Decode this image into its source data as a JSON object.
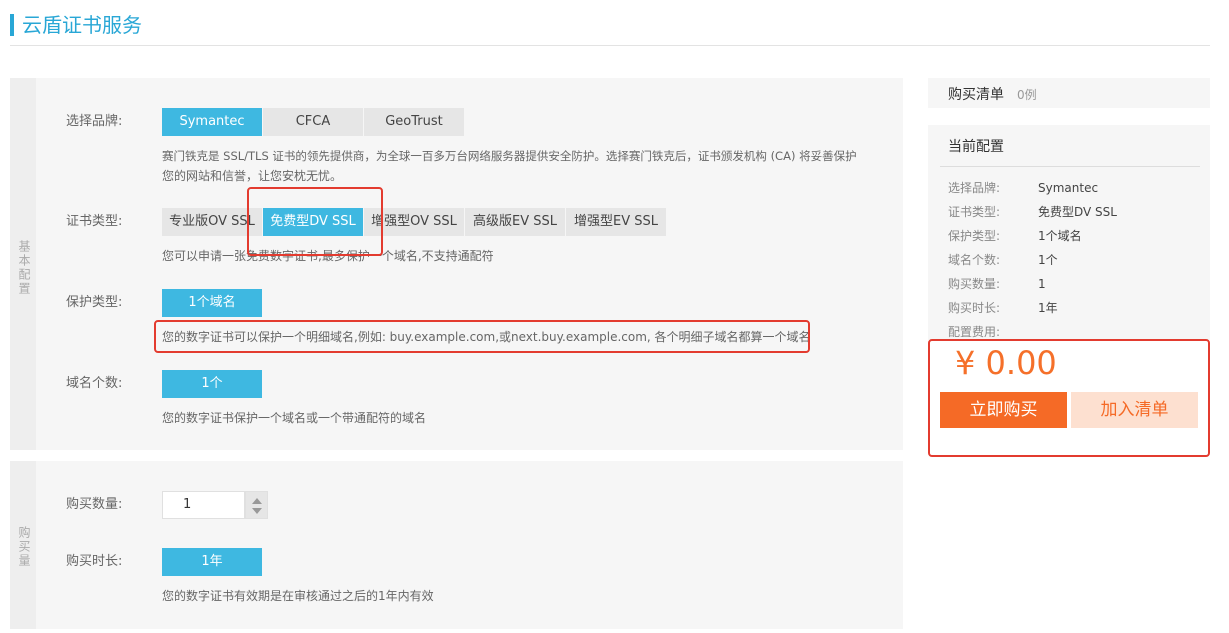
{
  "page": {
    "title": "云盾证书服务"
  },
  "sections": {
    "basic_label": "基本配置",
    "purchase_label": "购买量"
  },
  "brand": {
    "label": "选择品牌:",
    "options": [
      "Symantec",
      "CFCA",
      "GeoTrust"
    ],
    "selected": "Symantec",
    "description_line1": "赛门铁克是 SSL/TLS 证书的领先提供商，为全球一百多万台网络服务器提供安全防护。选择赛门铁克后，证书颁发机构 (CA) 将妥善保护",
    "description_line2": "您的网站和信誉，让您安枕无忧。"
  },
  "cert_type": {
    "label": "证书类型:",
    "options": [
      "专业版OV SSL",
      "免费型DV SSL",
      "增强型OV SSL",
      "高级版EV SSL",
      "增强型EV SSL"
    ],
    "selected": "免费型DV SSL",
    "description": "您可以申请一张免费数字证书,最多保护一个域名,不支持通配符"
  },
  "protect_type": {
    "label": "保护类型:",
    "options": [
      "1个域名"
    ],
    "selected": "1个域名",
    "description": "您的数字证书可以保护一个明细域名,例如: buy.example.com,或next.buy.example.com, 各个明细子域名都算一个域名"
  },
  "domain_count": {
    "label": "域名个数:",
    "options": [
      "1个"
    ],
    "selected": "1个",
    "description": "您的数字证书保护一个域名或一个带通配符的域名"
  },
  "quantity": {
    "label": "购买数量:",
    "value": "1"
  },
  "duration": {
    "label": "购买时长:",
    "options": [
      "1年"
    ],
    "selected": "1年",
    "description": "您的数字证书有效期是在审核通过之后的1年内有效"
  },
  "cart": {
    "title": "购买清单",
    "count": "0例"
  },
  "config": {
    "title": "当前配置",
    "rows": [
      {
        "label": "选择品牌:",
        "value": "Symantec"
      },
      {
        "label": "证书类型:",
        "value": "免费型DV SSL"
      },
      {
        "label": "保护类型:",
        "value": "1个域名"
      },
      {
        "label": "域名个数:",
        "value": "1个"
      },
      {
        "label": "购买数量:",
        "value": "1"
      },
      {
        "label": "购买时长:",
        "value": "1年"
      }
    ],
    "fee_label": "配置费用:",
    "price": "¥ 0.00",
    "buy_button": "立即购买",
    "add_button": "加入清单"
  },
  "colors": {
    "accent": "#29a7d6",
    "selected_option": "#3eb8e1",
    "highlight_border": "#e33b2f",
    "price": "#f5702a",
    "buy_button": "#f56a26",
    "add_button_bg": "#fde0d0"
  }
}
